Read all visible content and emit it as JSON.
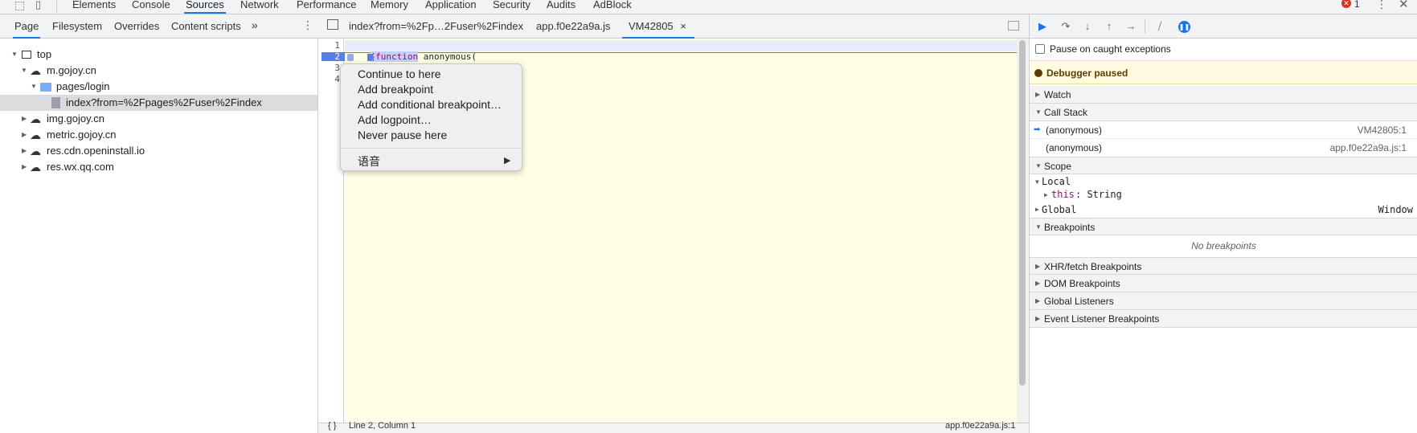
{
  "topbar": {
    "tabs": [
      "Elements",
      "Console",
      "Sources",
      "Network",
      "Performance",
      "Memory",
      "Application",
      "Security",
      "Audits",
      "AdBlock"
    ],
    "active_tab": "Sources",
    "error_count": "1"
  },
  "navigator": {
    "tabs": [
      "Page",
      "Filesystem",
      "Overrides",
      "Content scripts"
    ],
    "more": "»",
    "tree": {
      "top": "top",
      "m_gojoy": "m.gojoy.cn",
      "pages_login": "pages/login",
      "index_file": "index?from=%2Fpages%2Fuser%2Findex",
      "img_gojoy": "img.gojoy.cn",
      "metric_gojoy": "metric.gojoy.cn",
      "res_cdn": "res.cdn.openinstall.io",
      "res_wx": "res.wx.qq.com"
    }
  },
  "editor": {
    "tabs": [
      "index?from=%2Fp…2Fuser%2Findex",
      "app.f0e22a9a.js",
      "VM42805"
    ],
    "close": "×",
    "lines": [
      "1",
      "2",
      "3",
      "4"
    ],
    "code": {
      "l1_paren": "(",
      "l1_kw": "function",
      "l1_rest": " anonymous(",
      "l2": ") {"
    },
    "status": {
      "braces": "{ }",
      "position": "Line 2, Column 1",
      "source": "app.f0e22a9a.js:1"
    }
  },
  "context_menu": {
    "items": [
      "Continue to here",
      "Add breakpoint",
      "Add conditional breakpoint…",
      "Add logpoint…",
      "Never pause here"
    ],
    "speech": "语音",
    "arrow": "▶"
  },
  "debugger": {
    "pause_caught": "Pause on caught exceptions",
    "paused": "Debugger paused",
    "watch": "Watch",
    "call_stack": "Call Stack",
    "stack": [
      {
        "name": "(anonymous)",
        "loc": "VM42805:1"
      },
      {
        "name": "(anonymous)",
        "loc": "app.f0e22a9a.js:1"
      }
    ],
    "scope": "Scope",
    "local": "Local",
    "this_key": "this",
    "this_val": ": String",
    "global": "Global",
    "global_val": "Window",
    "breakpoints": "Breakpoints",
    "no_breakpoints": "No breakpoints",
    "xhr": "XHR/fetch Breakpoints",
    "dom": "DOM Breakpoints",
    "listeners": "Global Listeners",
    "event_listeners": "Event Listener Breakpoints"
  },
  "colors": {
    "accent": "#1a73e8",
    "paused_bg": "#fffbe0",
    "code_bg": "#ffffe5",
    "execution_line": "#1a73e8"
  }
}
